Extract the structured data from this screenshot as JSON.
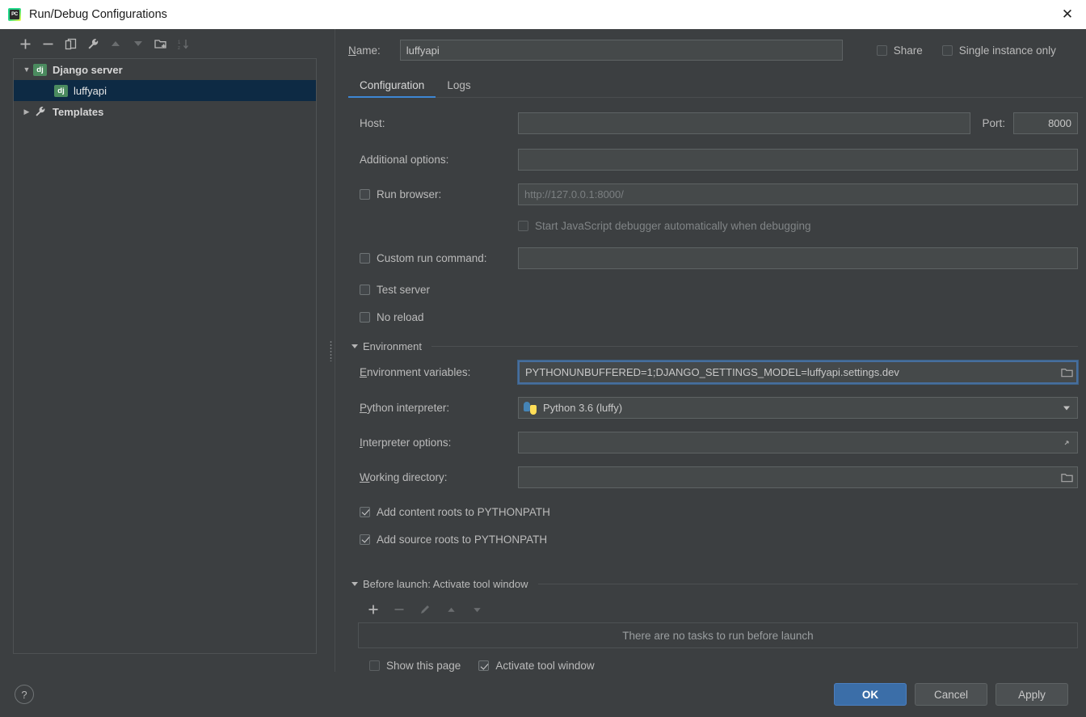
{
  "window": {
    "title": "Run/Debug Configurations",
    "app_icon": "pycharm-icon",
    "close_label": "✕"
  },
  "left_panel": {
    "toolbar": [
      {
        "name": "add-configuration-button",
        "icon": "plus-icon",
        "enabled": true
      },
      {
        "name": "remove-configuration-button",
        "icon": "minus-icon",
        "enabled": false
      },
      {
        "name": "copy-configuration-button",
        "icon": "copy-icon",
        "enabled": true
      },
      {
        "name": "edit-templates-button",
        "icon": "wrench-icon",
        "enabled": true
      },
      {
        "name": "move-up-button",
        "icon": "arrow-up-icon",
        "enabled": false
      },
      {
        "name": "move-down-button",
        "icon": "arrow-down-icon",
        "enabled": false
      },
      {
        "name": "new-folder-button",
        "icon": "folder-add-icon",
        "enabled": true
      },
      {
        "name": "sort-configurations-button",
        "icon": "sort-icon",
        "enabled": false
      }
    ],
    "tree": [
      {
        "label": "Django server",
        "icon": "dj",
        "badge": "dj",
        "expanded": true,
        "twisty": "▼",
        "selected": false,
        "child": false
      },
      {
        "label": "luffyapi",
        "icon": "dj",
        "badge": "dj",
        "expanded": false,
        "twisty": "",
        "selected": true,
        "child": true
      },
      {
        "label": "Templates",
        "icon": "wrench",
        "badge": "",
        "expanded": false,
        "twisty": "▶",
        "selected": false,
        "child": false
      }
    ]
  },
  "header": {
    "name_label": "Name:",
    "name_value": "luffyapi",
    "share_label": "Share",
    "share_checked": false,
    "single_instance_label": "Single instance only",
    "single_instance_checked": false
  },
  "tabs": [
    {
      "label": "Configuration",
      "active": true
    },
    {
      "label": "Logs",
      "active": false
    }
  ],
  "form": {
    "host_label": "Host:",
    "host_value": "",
    "port_label": "Port:",
    "port_value": "8000",
    "additional_options_label": "Additional options:",
    "additional_options_value": "",
    "run_browser_label": "Run browser:",
    "run_browser_checked": false,
    "run_browser_url": "http://127.0.0.1:8000/",
    "start_js_debugger_label": "Start JavaScript debugger automatically when debugging",
    "start_js_debugger_checked": false,
    "custom_run_command_label": "Custom run command:",
    "custom_run_command_checked": false,
    "custom_run_command_value": "",
    "test_server_label": "Test server",
    "test_server_checked": false,
    "no_reload_label": "No reload",
    "no_reload_checked": false,
    "environment_section_label": "Environment",
    "environment_variables_label": "Environment variables:",
    "environment_variables_value": "PYTHONUNBUFFERED=1;DJANGO_SETTINGS_MODEL=luffyapi.settings.dev",
    "python_interpreter_label": "Python interpreter:",
    "python_interpreter_value": "Python 3.6 (luffy)",
    "interpreter_options_label": "Interpreter options:",
    "interpreter_options_value": "",
    "working_directory_label": "Working directory:",
    "working_directory_value": "",
    "add_content_roots_label": "Add content roots to PYTHONPATH",
    "add_content_roots_checked": true,
    "add_source_roots_label": "Add source roots to PYTHONPATH",
    "add_source_roots_checked": true
  },
  "before_launch": {
    "section_label": "Before launch: Activate tool window",
    "toolbar": [
      {
        "name": "bl-add-task-button",
        "icon": "plus-icon",
        "enabled": true
      },
      {
        "name": "bl-remove-task-button",
        "icon": "minus-icon",
        "enabled": false
      },
      {
        "name": "bl-edit-task-button",
        "icon": "pencil-icon",
        "enabled": false
      },
      {
        "name": "bl-move-up-button",
        "icon": "arrow-up-icon",
        "enabled": false
      },
      {
        "name": "bl-move-down-button",
        "icon": "arrow-down-icon",
        "enabled": false
      }
    ],
    "empty_text": "There are no tasks to run before launch",
    "show_page_label": "Show this page",
    "show_page_checked": false,
    "activate_tool_window_label": "Activate tool window",
    "activate_tool_window_checked": true
  },
  "footer": {
    "help_label": "?",
    "ok_label": "OK",
    "cancel_label": "Cancel",
    "apply_label": "Apply"
  },
  "colors": {
    "dialog_bg": "#3c3f41",
    "field_bg": "#45494a",
    "selection_bg": "#0d2a44",
    "accent_blue": "#3d87d4",
    "primary_button": "#3b6ea8",
    "django_badge": "#4b8b5f"
  }
}
